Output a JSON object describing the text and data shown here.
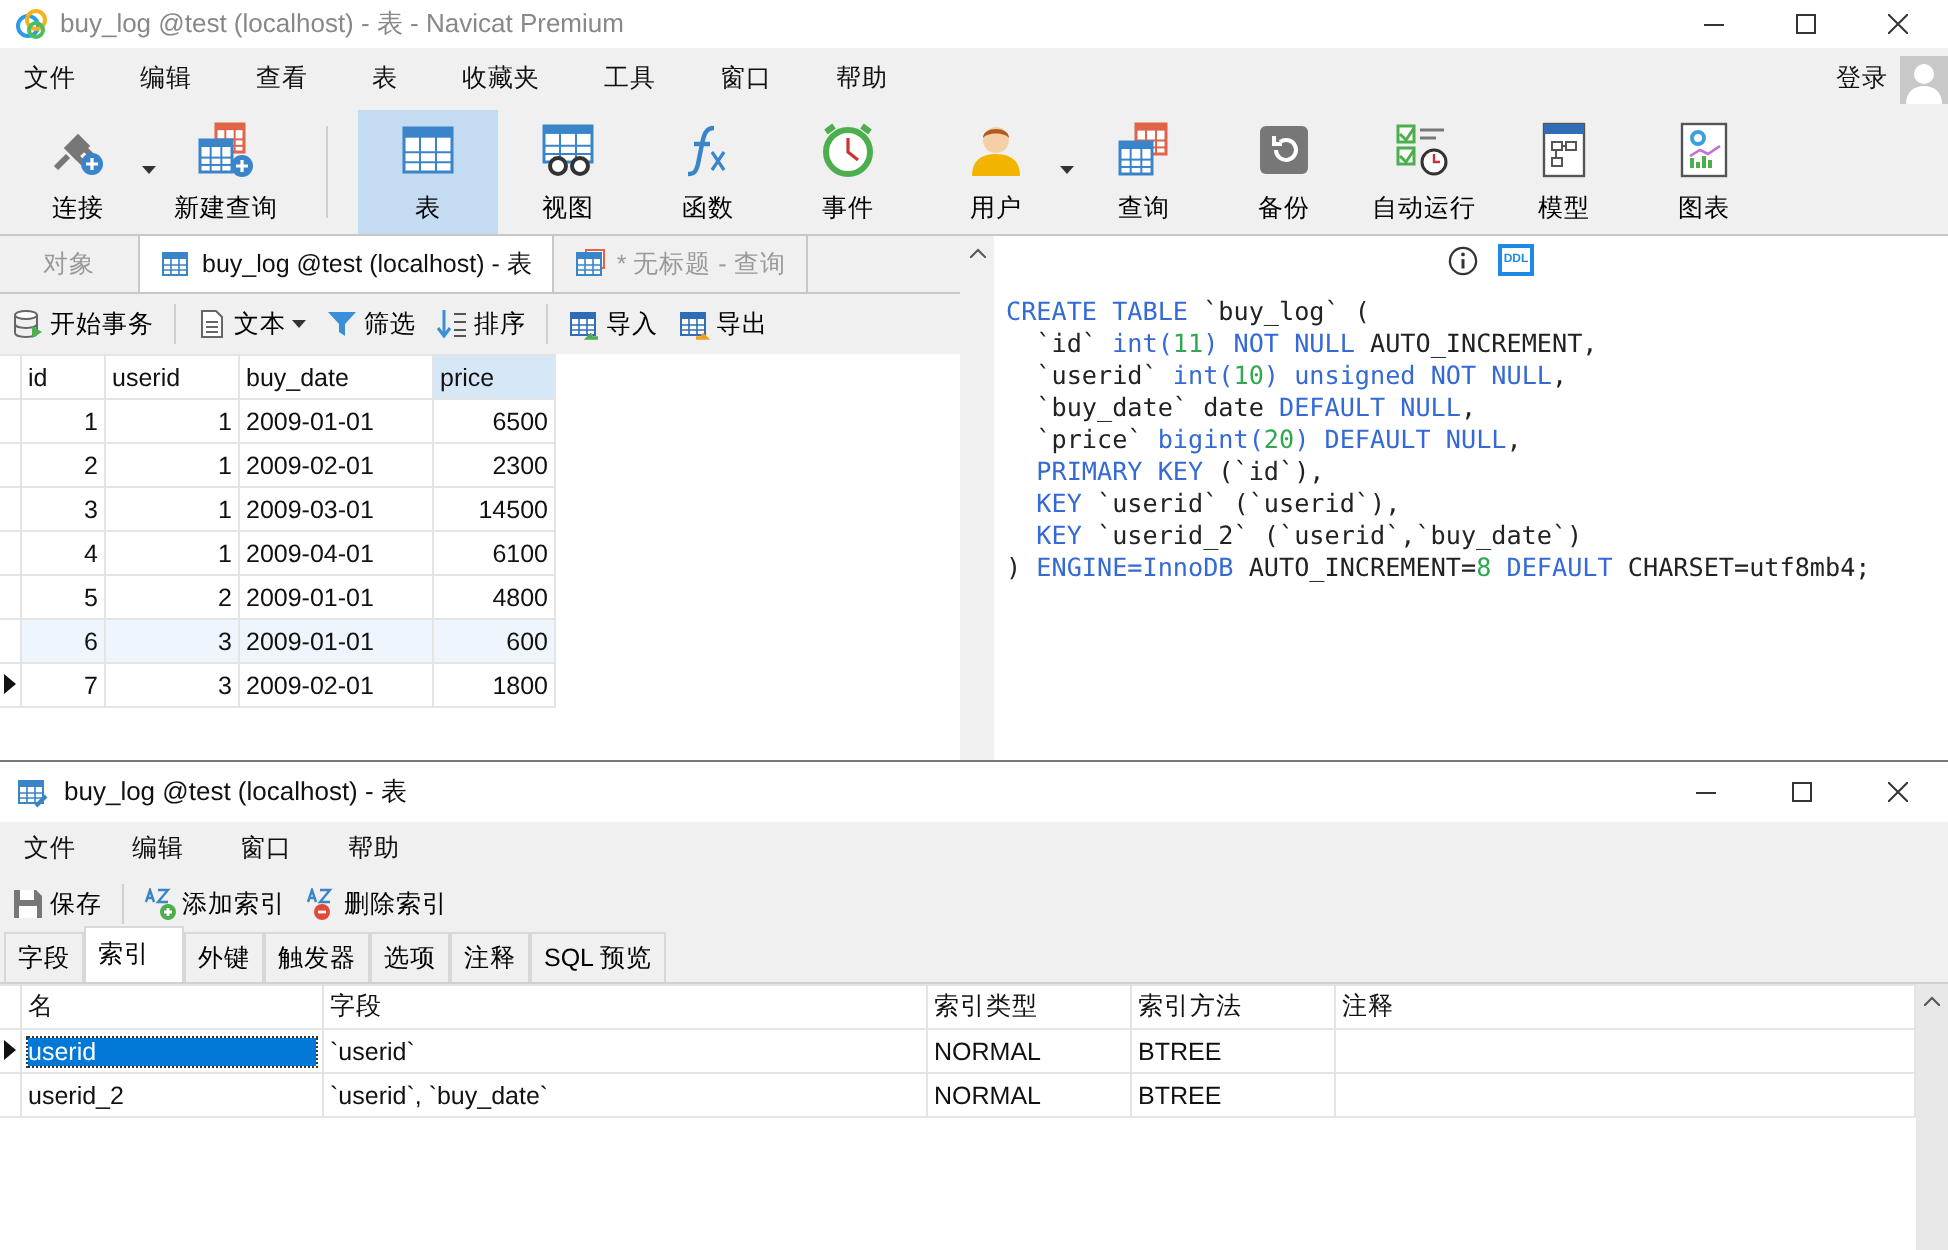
{
  "window": {
    "title": "buy_log @test (localhost) - 表 - Navicat Premium"
  },
  "menu": [
    "文件",
    "编辑",
    "查看",
    "表",
    "收藏夹",
    "工具",
    "窗口",
    "帮助"
  ],
  "login": "登录",
  "toolbar": [
    [
      {
        "label": "连接",
        "kind": "connect",
        "dropdown": true,
        "selected": false
      },
      {
        "label": "新建查询",
        "kind": "new-query",
        "dropdown": false,
        "selected": false
      }
    ],
    [
      {
        "label": "表",
        "kind": "table",
        "dropdown": false,
        "selected": true
      },
      {
        "label": "视图",
        "kind": "view",
        "dropdown": false,
        "selected": false
      },
      {
        "label": "函数",
        "kind": "function",
        "dropdown": false,
        "selected": false
      },
      {
        "label": "事件",
        "kind": "event",
        "dropdown": false,
        "selected": false
      },
      {
        "label": "用户",
        "kind": "user",
        "dropdown": true,
        "selected": false
      },
      {
        "label": "查询",
        "kind": "query",
        "dropdown": false,
        "selected": false
      },
      {
        "label": "备份",
        "kind": "backup",
        "dropdown": false,
        "selected": false
      },
      {
        "label": "自动运行",
        "kind": "schedule",
        "dropdown": false,
        "selected": false
      },
      {
        "label": "模型",
        "kind": "model",
        "dropdown": false,
        "selected": false
      },
      {
        "label": "图表",
        "kind": "chart",
        "dropdown": false,
        "selected": false
      }
    ]
  ],
  "tabs": [
    {
      "label": "对象",
      "kind": "plain",
      "selected": false
    },
    {
      "label": "buy_log @test (localhost) - 表",
      "kind": "table",
      "selected": true
    },
    {
      "label": "* 无标题 - 查询",
      "kind": "query",
      "selected": false
    }
  ],
  "data_toolbar": [
    [
      {
        "label": "开始事务",
        "kind": "transaction",
        "dropdown": false
      }
    ],
    [
      {
        "label": "文本",
        "kind": "text",
        "dropdown": true
      },
      {
        "label": "筛选",
        "kind": "filter",
        "dropdown": false
      },
      {
        "label": "排序",
        "kind": "sort",
        "dropdown": false
      }
    ],
    [
      {
        "label": "导入",
        "kind": "import",
        "dropdown": false
      },
      {
        "label": "导出",
        "kind": "export",
        "dropdown": false
      }
    ]
  ],
  "data_grid": {
    "columns": [
      {
        "label": "id",
        "selected": false
      },
      {
        "label": "userid",
        "selected": false
      },
      {
        "label": "buy_date",
        "selected": false
      },
      {
        "label": "price",
        "selected": true
      }
    ],
    "rows": [
      {
        "cells": [
          "1",
          "1",
          "2009-01-01",
          "6500"
        ],
        "selected": false,
        "highlighted": false
      },
      {
        "cells": [
          "2",
          "1",
          "2009-02-01",
          "2300"
        ],
        "selected": false,
        "highlighted": false
      },
      {
        "cells": [
          "3",
          "1",
          "2009-03-01",
          "14500"
        ],
        "selected": false,
        "highlighted": false
      },
      {
        "cells": [
          "4",
          "1",
          "2009-04-01",
          "6100"
        ],
        "selected": false,
        "highlighted": false
      },
      {
        "cells": [
          "5",
          "2",
          "2009-01-01",
          "4800"
        ],
        "selected": false,
        "highlighted": false
      },
      {
        "cells": [
          "6",
          "3",
          "2009-01-01",
          "600"
        ],
        "selected": false,
        "highlighted": true
      },
      {
        "cells": [
          "7",
          "3",
          "2009-02-01",
          "1800"
        ],
        "selected": true,
        "highlighted": false
      }
    ]
  },
  "ddl": {
    "badge": "DDL",
    "lines": [
      [
        {
          "kind": "keyword",
          "t": "CREATE TABLE"
        },
        {
          "kind": "plain",
          "t": " `buy_log` ("
        }
      ],
      [
        {
          "kind": "plain",
          "t": "  `id` "
        },
        {
          "kind": "keyword",
          "t": "int("
        },
        {
          "kind": "number",
          "t": "11"
        },
        {
          "kind": "keyword",
          "t": ") NOT NULL"
        },
        {
          "kind": "plain",
          "t": " AUTO_INCREMENT,"
        }
      ],
      [
        {
          "kind": "plain",
          "t": "  `userid` "
        },
        {
          "kind": "keyword",
          "t": "int("
        },
        {
          "kind": "number",
          "t": "10"
        },
        {
          "kind": "keyword",
          "t": ") unsigned NOT NULL"
        },
        {
          "kind": "plain",
          "t": ","
        }
      ],
      [
        {
          "kind": "plain",
          "t": "  `buy_date` date "
        },
        {
          "kind": "keyword",
          "t": "DEFAULT NULL"
        },
        {
          "kind": "plain",
          "t": ","
        }
      ],
      [
        {
          "kind": "plain",
          "t": "  `price` "
        },
        {
          "kind": "keyword",
          "t": "bigint("
        },
        {
          "kind": "number",
          "t": "20"
        },
        {
          "kind": "keyword",
          "t": ") DEFAULT NULL"
        },
        {
          "kind": "plain",
          "t": ","
        }
      ],
      [
        {
          "kind": "keyword",
          "t": "  PRIMARY KEY"
        },
        {
          "kind": "plain",
          "t": " (`id`),"
        }
      ],
      [
        {
          "kind": "keyword",
          "t": "  KEY"
        },
        {
          "kind": "plain",
          "t": " `userid` (`userid`),"
        }
      ],
      [
        {
          "kind": "keyword",
          "t": "  KEY"
        },
        {
          "kind": "plain",
          "t": " `userid_2` (`userid`,`buy_date`)"
        }
      ],
      [
        {
          "kind": "plain",
          "t": ") "
        },
        {
          "kind": "keyword",
          "t": "ENGINE=InnoDB"
        },
        {
          "kind": "plain",
          "t": " AUTO_INCREMENT="
        },
        {
          "kind": "number",
          "t": "8"
        },
        {
          "kind": "keyword",
          "t": " DEFAULT"
        },
        {
          "kind": "plain",
          "t": " CHARSET=utf8mb4;"
        }
      ]
    ]
  },
  "designer": {
    "title": "buy_log @test (localhost) - 表",
    "menu": [
      "文件",
      "编辑",
      "窗口",
      "帮助"
    ],
    "toolbar": [
      [
        {
          "label": "保存",
          "kind": "save"
        }
      ],
      [
        {
          "label": "添加索引",
          "kind": "add-index"
        },
        {
          "label": "删除索引",
          "kind": "delete-index"
        }
      ]
    ],
    "tabs": [
      {
        "label": "字段",
        "selected": false
      },
      {
        "label": "索引",
        "selected": true
      },
      {
        "label": "外键",
        "selected": false
      },
      {
        "label": "触发器",
        "selected": false
      },
      {
        "label": "选项",
        "selected": false
      },
      {
        "label": "注释",
        "selected": false
      },
      {
        "label": "SQL 预览",
        "selected": false
      }
    ],
    "grid": {
      "columns": [
        "名",
        "字段",
        "索引类型",
        "索引方法",
        "注释"
      ],
      "rows": [
        {
          "cells": [
            "userid",
            "`userid`",
            "NORMAL",
            "BTREE"
          ],
          "selected": true
        },
        {
          "cells": [
            "userid_2",
            "`userid`, `buy_date`",
            "NORMAL",
            "BTREE"
          ],
          "selected": false
        }
      ]
    }
  }
}
